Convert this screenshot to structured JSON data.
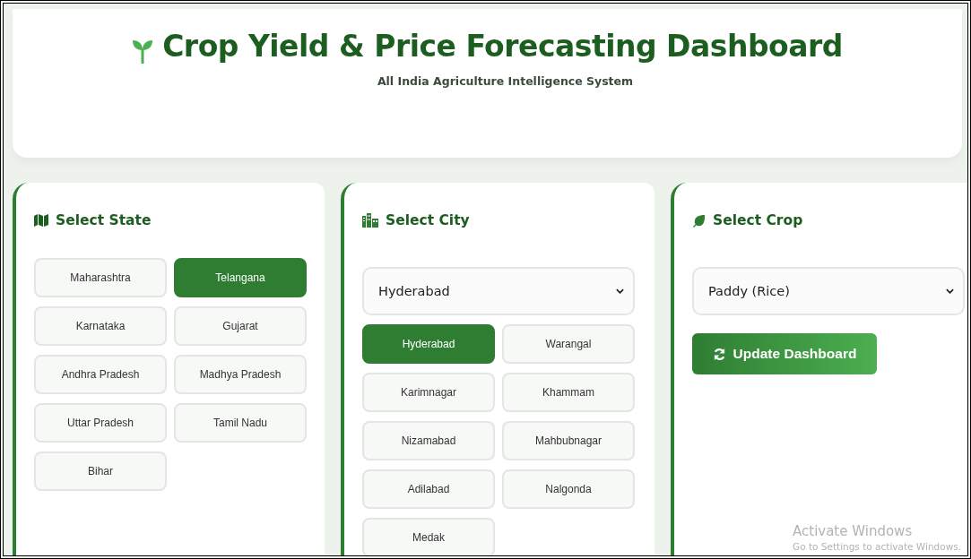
{
  "header": {
    "title": "Crop Yield & Price Forecasting Dashboard",
    "subtitle": "All India Agriculture Intelligence System"
  },
  "panels": [
    {
      "kind": "state",
      "title": "Select State",
      "options": [
        {
          "label": "Maharashtra",
          "selected": false
        },
        {
          "label": "Telangana",
          "selected": true
        },
        {
          "label": "Karnataka",
          "selected": false
        },
        {
          "label": "Gujarat",
          "selected": false
        },
        {
          "label": "Andhra Pradesh",
          "selected": false
        },
        {
          "label": "Madhya Pradesh",
          "selected": false
        },
        {
          "label": "Uttar Pradesh",
          "selected": false
        },
        {
          "label": "Tamil Nadu",
          "selected": false
        },
        {
          "label": "Bihar",
          "selected": false
        }
      ]
    },
    {
      "kind": "city",
      "title": "Select City",
      "dropdown": {
        "value": "Hyderabad"
      },
      "options": [
        {
          "label": "Hyderabad",
          "selected": true
        },
        {
          "label": "Warangal",
          "selected": false
        },
        {
          "label": "Karimnagar",
          "selected": false
        },
        {
          "label": "Khammam",
          "selected": false
        },
        {
          "label": "Nizamabad",
          "selected": false
        },
        {
          "label": "Mahbubnagar",
          "selected": false
        },
        {
          "label": "Adilabad",
          "selected": false
        },
        {
          "label": "Nalgonda",
          "selected": false
        },
        {
          "label": "Medak",
          "selected": false
        }
      ]
    },
    {
      "kind": "crop",
      "title": "Select Crop",
      "dropdown": {
        "value": "Paddy (Rice)"
      },
      "button": {
        "label": "Update Dashboard"
      }
    }
  ],
  "os_notice": {
    "title": "Activate Windows",
    "message": "Go to Settings to activate Windows."
  }
}
